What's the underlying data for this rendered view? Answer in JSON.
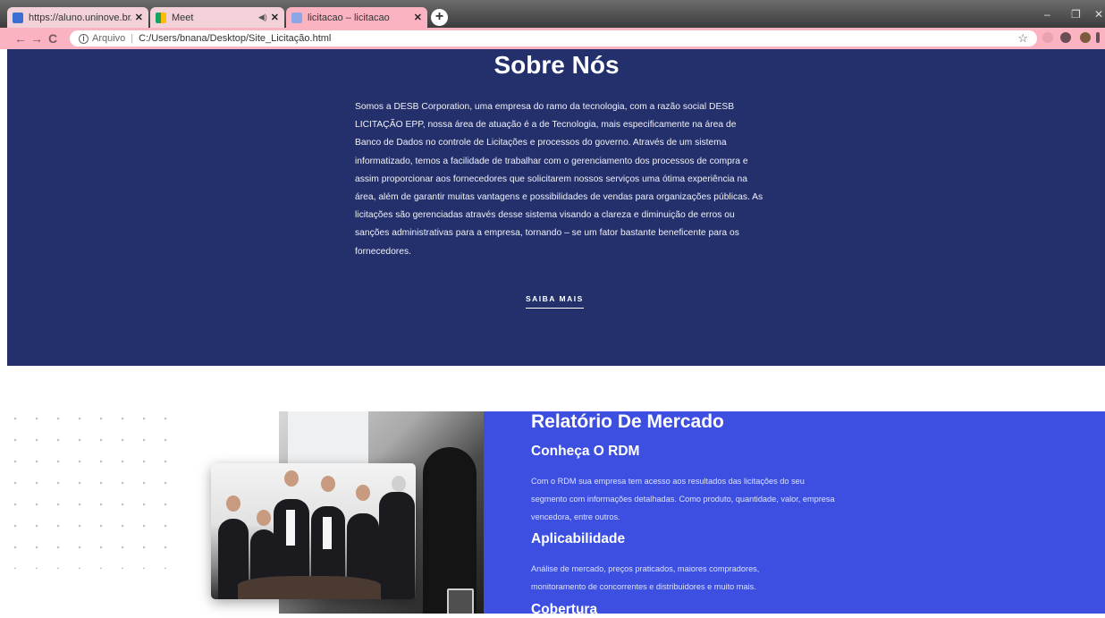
{
  "browser": {
    "tabs": [
      {
        "title": "https://aluno.uninove.br/sala_on",
        "icon": "uninove-favicon"
      },
      {
        "title": "Meet",
        "icon": "meet-favicon"
      },
      {
        "title": "licitacao – licitacao",
        "icon": "page-favicon",
        "active": true
      }
    ],
    "address": {
      "security_label": "Arquivo",
      "url": "C:/Users/bnana/Desktop/Site_Licitação.html"
    },
    "colors": {
      "chrome": "#fbb3c2",
      "tabbar": "#4a4a4a"
    }
  },
  "sobre": {
    "title": "Sobre Nós",
    "paragraph": "Somos a DESB Corporation, uma empresa do ramo da tecnologia, com a razão social DESB LICITAÇÃO EPP, nossa área de atuação é a de Tecnologia, mais especificamente na área de Banco de Dados no controle de Licitações e processos do governo. Através de um sistema informatizado, temos a facilidade de trabalhar com o gerenciamento dos processos de compra e assim proporcionar aos fornecedores que solicitarem nossos serviços uma ótima experiência na área, além de garantir muitas vantagens e possibilidades de vendas para organizações públicas. As licitações são gerenciadas através desse sistema visando a clareza e diminuição de erros ou sanções administrativas para a empresa, tornando – se um fator bastante beneficente para os fornecedores.",
    "button": "SAIBA MAIS",
    "bg_color": "#23306c"
  },
  "mercado": {
    "title": "Relatório De Mercado",
    "sections": [
      {
        "heading": "Conheça O RDM",
        "text": "Com o RDM sua empresa tem acesso aos resultados das licitações do seu segmento com informações detalhadas. Como produto, quantidade, valor, empresa vencedora, entre outros."
      },
      {
        "heading": "Aplicabilidade",
        "text": "Análise de mercado, preços praticados, maiores compradores, monitoramento de concorrentes e distribuidores e muito mais."
      },
      {
        "heading": "Cobertura",
        "text": ""
      }
    ],
    "bg_color": "#3c4fe0"
  }
}
